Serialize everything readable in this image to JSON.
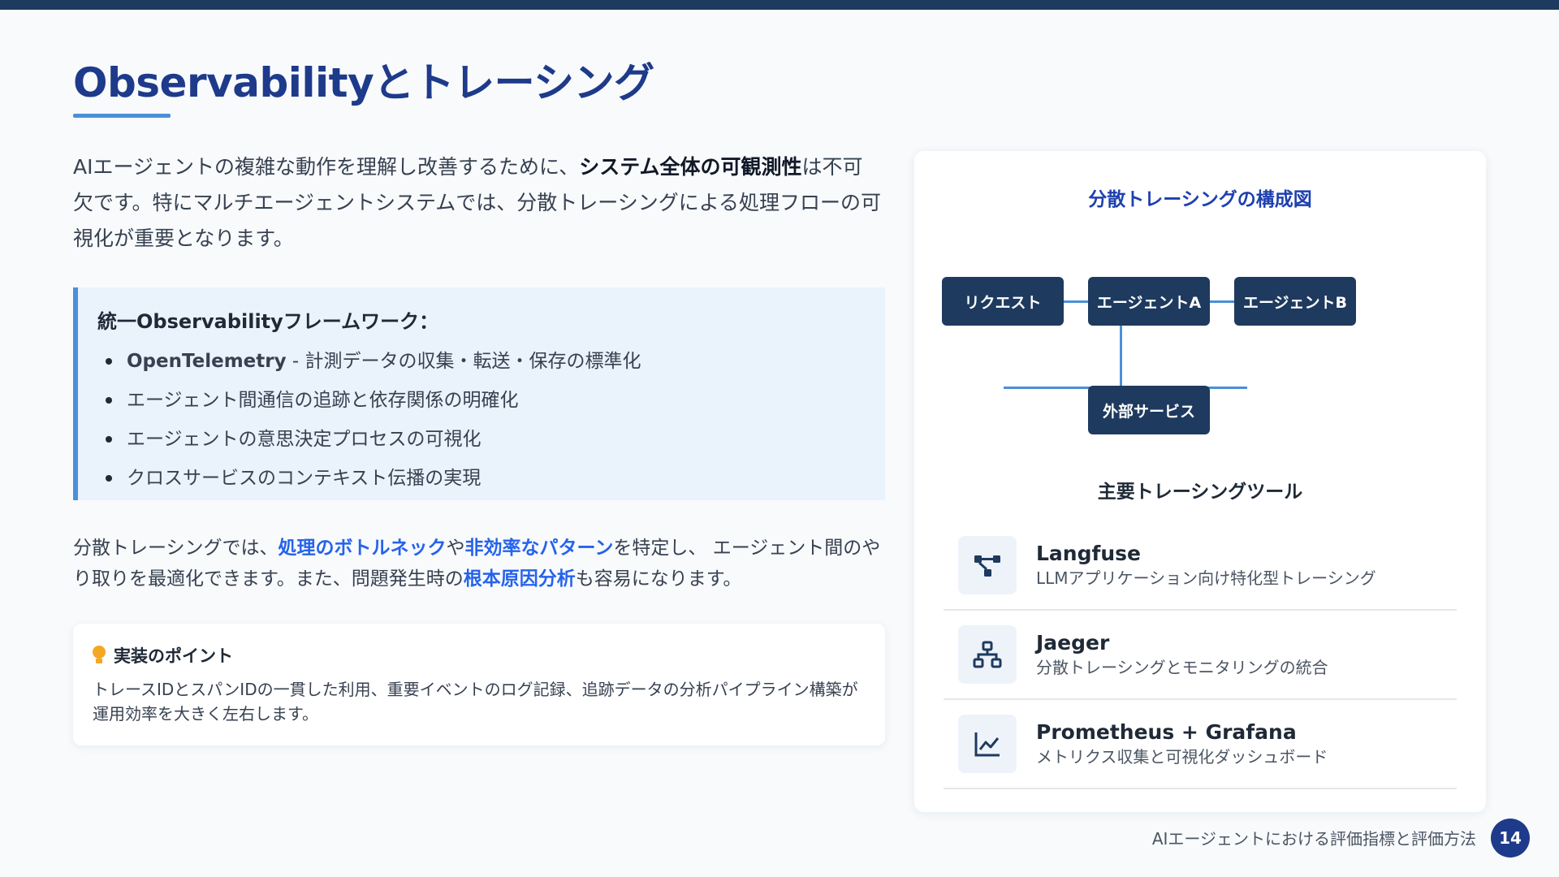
{
  "slide": {
    "title": "Observabilityとトレーシング",
    "intro": {
      "part1": "AIエージェントの複雑な動作を理解し改善するために、",
      "bold": "システム全体の可観測性",
      "part2": "は不可欠です。特にマルチエージェントシステムでは、分散トレーシングによる処理フローの可視化が重要となります。"
    },
    "framework": {
      "heading": "統一Observabilityフレームワーク：",
      "items": [
        {
          "bold": "OpenTelemetry",
          "text": " - 計測データの収集・転送・保存の標準化"
        },
        {
          "text": "エージェント間通信の追跡と依存関係の明確化"
        },
        {
          "text": "エージェントの意思決定プロセスの可視化"
        },
        {
          "text": "クロスサービスのコンテキスト伝播の実現"
        }
      ]
    },
    "para2": {
      "t1": "分散トレーシングでは、",
      "h1": "処理のボトルネック",
      "t2": "や",
      "h2": "非効率なパターン",
      "t3": "を特定し、 エージェント間のやり取りを最適化できます。また、問題発生時の",
      "h3": "根本原因分析",
      "t4": "も容易になります。"
    },
    "tip": {
      "icon": "lightbulb-icon",
      "heading": "実装のポイント",
      "text": "トレースIDとスパンIDの一貫した利用、重要イベントのログ記録、追跡データの分析パイプライン構築が運用効率を大きく左右します。"
    },
    "diagram": {
      "title": "分散トレーシングの構成図",
      "nodes": {
        "request": "リクエスト",
        "agent_a": "エージェントA",
        "agent_b": "エージェントB",
        "external": "外部サービス"
      }
    },
    "tools": {
      "title": "主要トレーシングツール",
      "items": [
        {
          "name": "Langfuse",
          "desc": "LLMアプリケーション向け特化型トレーシング",
          "icon": "branch-icon"
        },
        {
          "name": "Jaeger",
          "desc": "分散トレーシングとモニタリングの統合",
          "icon": "network-icon"
        },
        {
          "name": "Prometheus + Grafana",
          "desc": "メトリクス収集と可視化ダッシュボード",
          "icon": "line-chart-icon"
        }
      ]
    },
    "footer": {
      "text": "AIエージェントにおける評価指標と評価方法",
      "page": "14"
    },
    "colors": {
      "accent": "#4a90d9",
      "primary": "#1e3a8a",
      "node": "#1e3a5f",
      "highlight": "#2563eb",
      "bulb": "#f5a623"
    }
  }
}
